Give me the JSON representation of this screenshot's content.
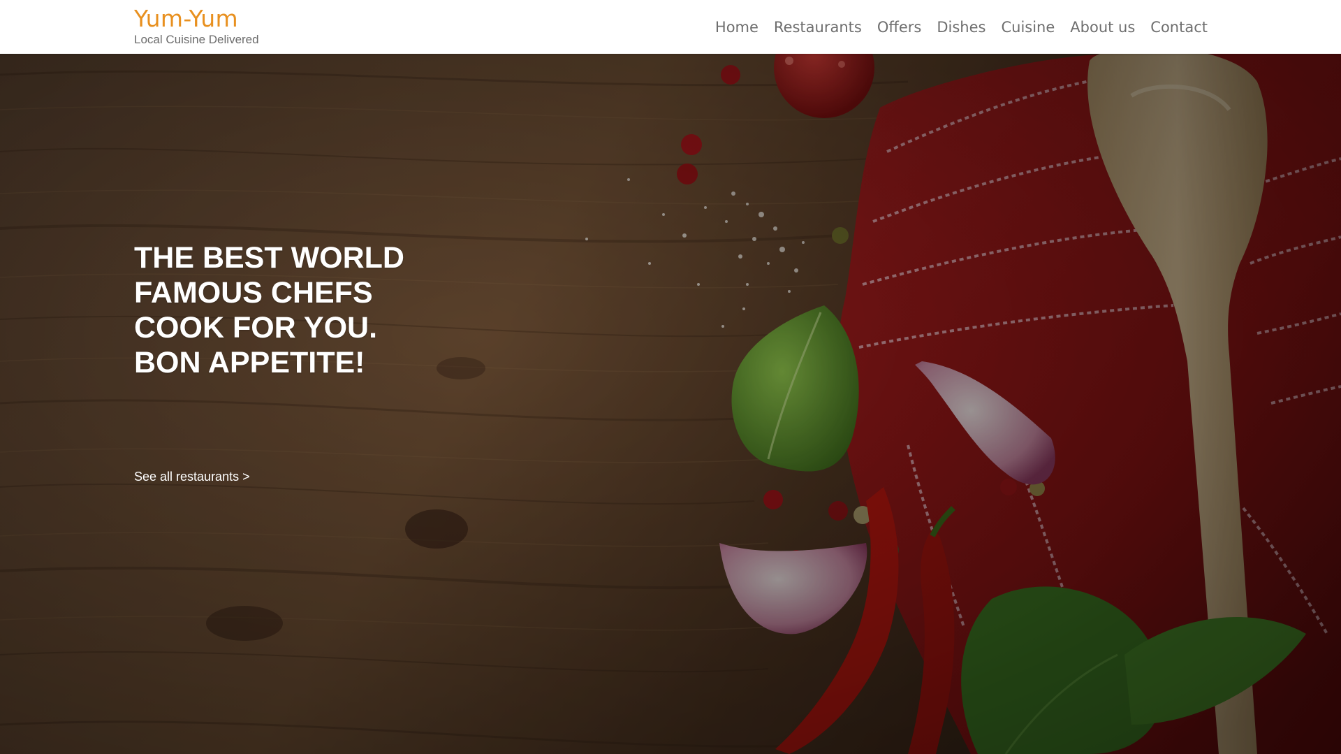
{
  "brand": {
    "name": "Yum-Yum",
    "tagline": "Local Cuisine Delivered",
    "color": "#e8901f"
  },
  "nav": {
    "items": [
      {
        "label": "Home"
      },
      {
        "label": "Restaurants"
      },
      {
        "label": "Offers"
      },
      {
        "label": "Dishes"
      },
      {
        "label": "Cuisine"
      },
      {
        "label": "About us"
      },
      {
        "label": "Contact"
      }
    ]
  },
  "hero": {
    "title": "THE BEST WORLD\nFAMOUS CHEFS\nCOOK FOR YOU.\nBON APPETITE!",
    "link_label": "See all restaurants >",
    "background": "wooden-table-with-red-towel-spoon-tomatoes-garlic-chili-basil"
  }
}
